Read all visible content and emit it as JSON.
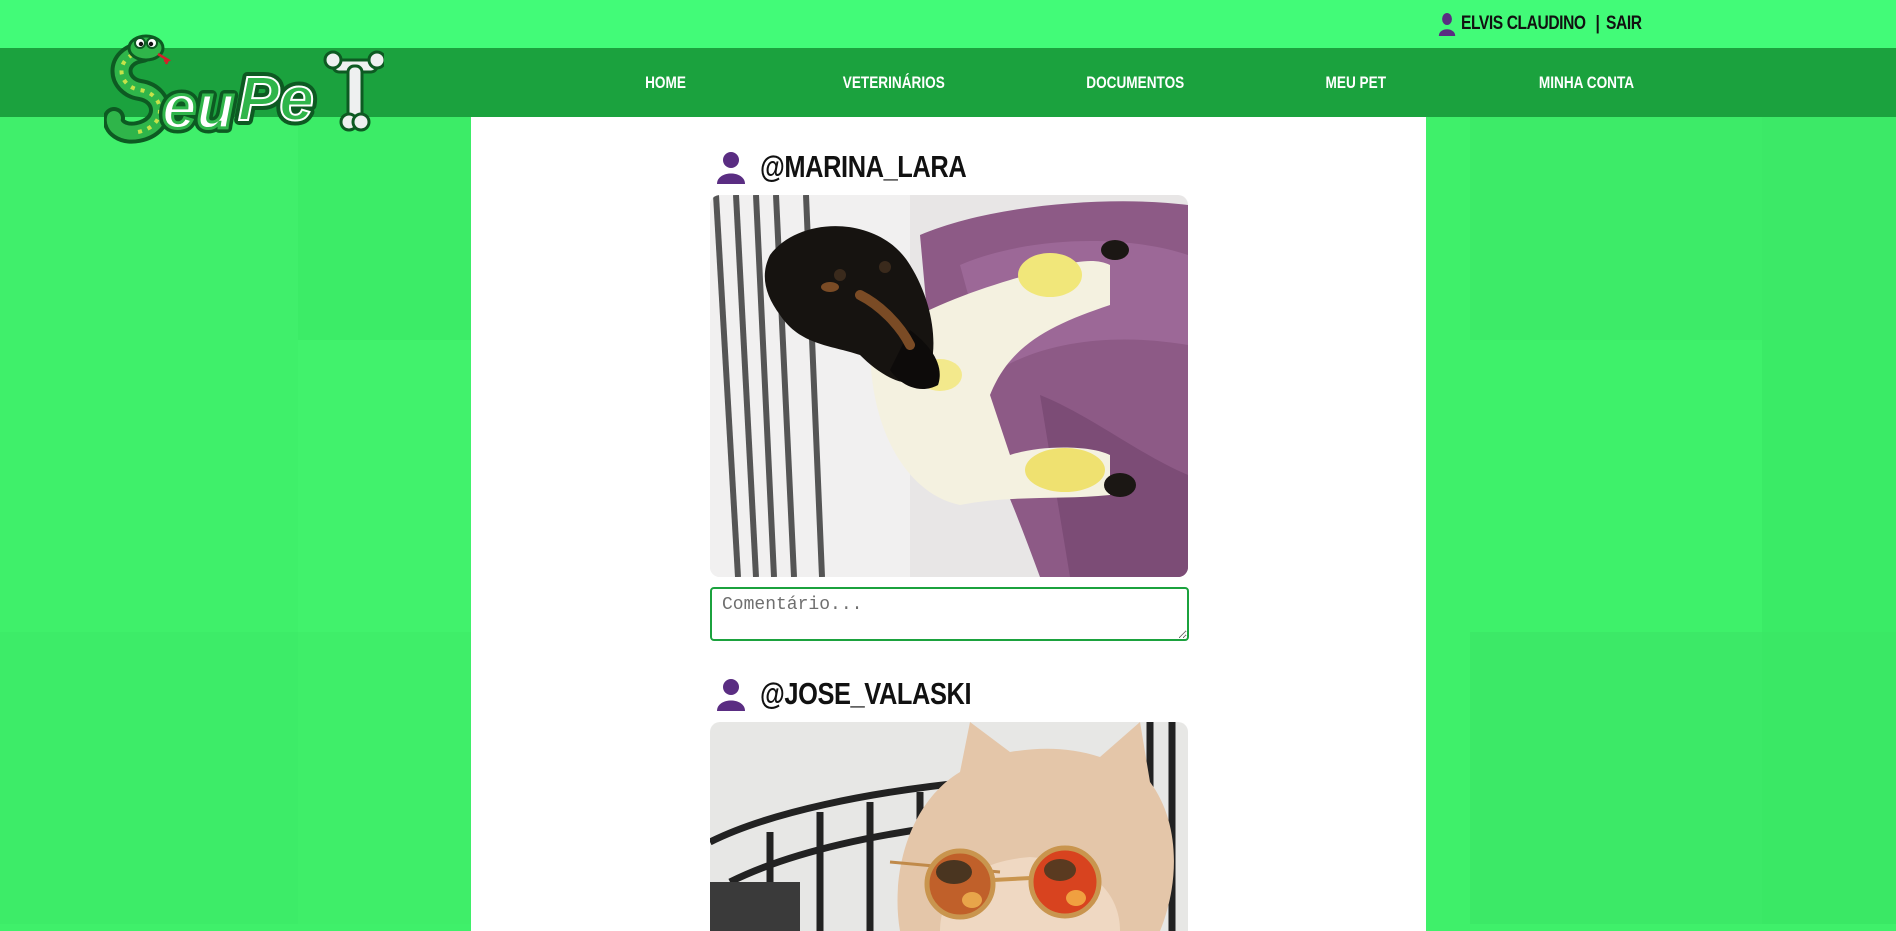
{
  "topbar": {
    "user_icon": "user-icon",
    "user_name": "ELVIS CLAUDINO",
    "separator": "|",
    "logout": "SAIR"
  },
  "logo": {
    "text_a": "eu",
    "text_b": "Pe"
  },
  "nav": {
    "items": [
      {
        "label": "HOME"
      },
      {
        "label": "VETERINÁRIOS"
      },
      {
        "label": "DOCUMENTOS"
      },
      {
        "label": "MEU PET"
      },
      {
        "label": "MINHA CONTA"
      }
    ]
  },
  "posts": [
    {
      "user": "@MARINA_LARA",
      "icon": "user-icon",
      "image": "dachshund-in-pajamas",
      "comment_placeholder": "Comentário..."
    },
    {
      "user": "@JOSE_VALASKI",
      "icon": "user-icon",
      "image": "cat-with-sunglasses"
    }
  ],
  "colors": {
    "topbar": "#42fb78",
    "navbar": "#1ba23e",
    "background": "#3ff06a",
    "user_icon": "#5a2d82"
  }
}
